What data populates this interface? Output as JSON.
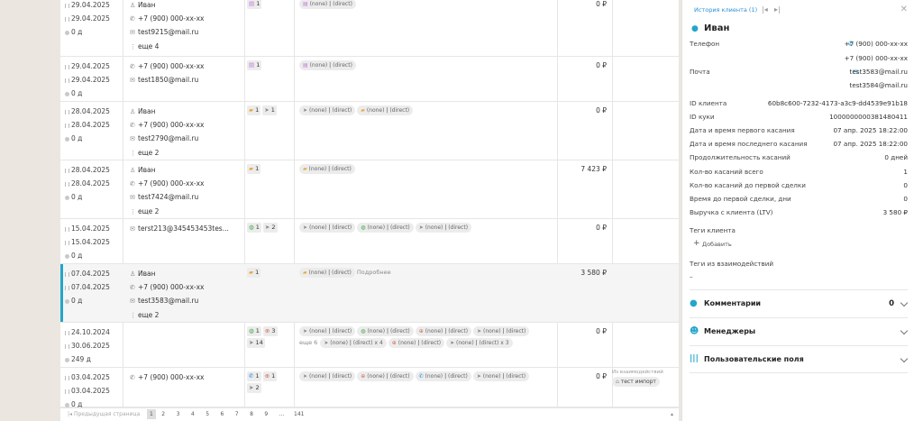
{
  "rows": [
    {
      "first": "29.04.2025",
      "last": "29.04.2025",
      "dur": "0 д",
      "name": "Иван",
      "phone": "+7 (900) 000-xx-xx",
      "email": "test9215@mail.ru",
      "more": "еще 4",
      "chan_count": "1",
      "chan_icon": "form",
      "sources": [
        {
          "icon": "form",
          "a": "(none)",
          "b": "(direct)"
        }
      ],
      "sum": "0 ₽"
    },
    {
      "first": "29.04.2025",
      "last": "29.04.2025",
      "dur": "0 д",
      "phone": "+7 (900) 000-xx-xx",
      "email": "test1850@mail.ru",
      "chan_count": "1",
      "chan_icon": "form",
      "sources": [
        {
          "icon": "form",
          "a": "(none)",
          "b": "(direct)"
        }
      ],
      "sum": "0 ₽"
    },
    {
      "first": "28.04.2025",
      "last": "28.04.2025",
      "dur": "0 д",
      "name": "Иван",
      "phone": "+7 (900) 000-xx-xx",
      "email": "test2790@mail.ru",
      "more": "еще 2",
      "chan_count": "1",
      "chan2_count": "1",
      "sources": [
        {
          "icon": "send",
          "a": "(none)",
          "b": "(direct)"
        },
        {
          "icon": "folder",
          "a": "(none)",
          "b": "(direct)"
        }
      ],
      "sum": "0 ₽"
    },
    {
      "first": "28.04.2025",
      "last": "28.04.2025",
      "dur": "0 д",
      "name": "Иван",
      "phone": "+7 (900) 000-xx-xx",
      "email": "test7424@mail.ru",
      "more": "еще 2",
      "chan_count": "1",
      "sources": [
        {
          "icon": "folder",
          "a": "(none)",
          "b": "(direct)"
        }
      ],
      "sum": "7 423 ₽"
    },
    {
      "first": "15.04.2025",
      "last": "15.04.2025",
      "dur": "0 д",
      "email": "terst213@345453453tes...",
      "chan_count": "1",
      "chan2_count": "2",
      "sources": [
        {
          "icon": "send",
          "a": "(none)",
          "b": "(direct)"
        },
        {
          "icon": "chat",
          "a": "(none)",
          "b": "(direct)"
        },
        {
          "icon": "send",
          "a": "(none)",
          "b": "(direct)"
        }
      ],
      "sum": "0 ₽"
    },
    {
      "first": "07.04.2025",
      "last": "07.04.2025",
      "dur": "0 д",
      "name": "Иван",
      "phone": "+7 (900) 000-xx-xx",
      "email": "test3583@mail.ru",
      "more": "еще 2",
      "chan_count": "1",
      "sources": [
        {
          "icon": "folder",
          "a": "(none)",
          "b": "(direct)"
        }
      ],
      "details": "Подробнее",
      "sum": "3 580 ₽"
    },
    {
      "first": "24.10.2024",
      "last": "30.06.2025",
      "dur": "249 д",
      "chan_count": "1",
      "chan2_count": "3",
      "chan3_count": "14",
      "sources": [
        {
          "icon": "send",
          "a": "(none)",
          "b": "(direct)"
        },
        {
          "icon": "chat",
          "a": "(none)",
          "b": "(direct)"
        },
        {
          "icon": "target",
          "a": "(none)",
          "b": "(direct)"
        },
        {
          "icon": "send",
          "a": "(none)",
          "b": "(direct)"
        }
      ],
      "more_src": "еще 6",
      "sources2": [
        {
          "icon": "send",
          "a": "(none)",
          "b": "(direct)",
          "x": "x 4"
        },
        {
          "icon": "target",
          "a": "(none)",
          "b": "(direct)"
        },
        {
          "icon": "send",
          "a": "(none)",
          "b": "(direct)",
          "x": "x 3"
        }
      ],
      "sum": "0 ₽"
    },
    {
      "first": "03.04.2025",
      "last": "03.04.2025",
      "dur": "0 д",
      "phone": "+7 (900) 000-xx-xx",
      "chan_count": "1",
      "chan2_count": "1",
      "chan3_count": "2",
      "sources": [
        {
          "icon": "send",
          "a": "(none)",
          "b": "(direct)"
        },
        {
          "icon": "target",
          "a": "(none)",
          "b": "(direct)"
        },
        {
          "icon": "phone",
          "a": "(none)",
          "b": "(direct)"
        },
        {
          "icon": "send",
          "a": "(none)",
          "b": "(direct)"
        }
      ],
      "sum": "0 ₽",
      "tag_label": "Из взаимодействий",
      "tag": "тест импорт"
    }
  ],
  "pager": {
    "prev": "Предыдущая страница",
    "pages": [
      "1",
      "2",
      "3",
      "4",
      "5",
      "6",
      "7",
      "8",
      "9",
      "...",
      "141"
    ],
    "current": "1"
  },
  "panel": {
    "history_link": "История клиента (1)",
    "name": "Иван",
    "phone_label": "Телефон",
    "phone1": "+7 (900) 000-xx-xx",
    "phone2": "+7 (900) 000-xx-xx",
    "email_label": "Почта",
    "email1": "test3583@mail.ru",
    "email2": "test3584@mail.ru",
    "fields": [
      {
        "label": "ID клиента",
        "value": "60b8c600-7232-4173-a3c9-dd4539e91b18"
      },
      {
        "label": "ID куки",
        "value": "1000000000381480411"
      },
      {
        "label": "Дата и время первого касания",
        "value": "07 апр. 2025 18:22:00"
      },
      {
        "label": "Дата и время последнего касания",
        "value": "07 апр. 2025 18:22:00"
      },
      {
        "label": "Продолжительность касаний",
        "value": "0 дней"
      },
      {
        "label": "Кол-во касаний всего",
        "value": "1"
      },
      {
        "label": "Кол-во касаний до первой сделки",
        "value": "0"
      },
      {
        "label": "Время до первой сделки, дни",
        "value": "0"
      },
      {
        "label": "Выручка с клиента (LTV)",
        "value": "3 580 ₽"
      }
    ],
    "client_tags_label": "Теги клиента",
    "add_label": "Добавить",
    "interaction_tags_label": "Теги из взаимодействий",
    "interaction_tags_value": "–",
    "comments_label": "Комментарии",
    "comments_count": "0",
    "managers_label": "Менеджеры",
    "custom_fields_label": "Пользовательские поля"
  }
}
